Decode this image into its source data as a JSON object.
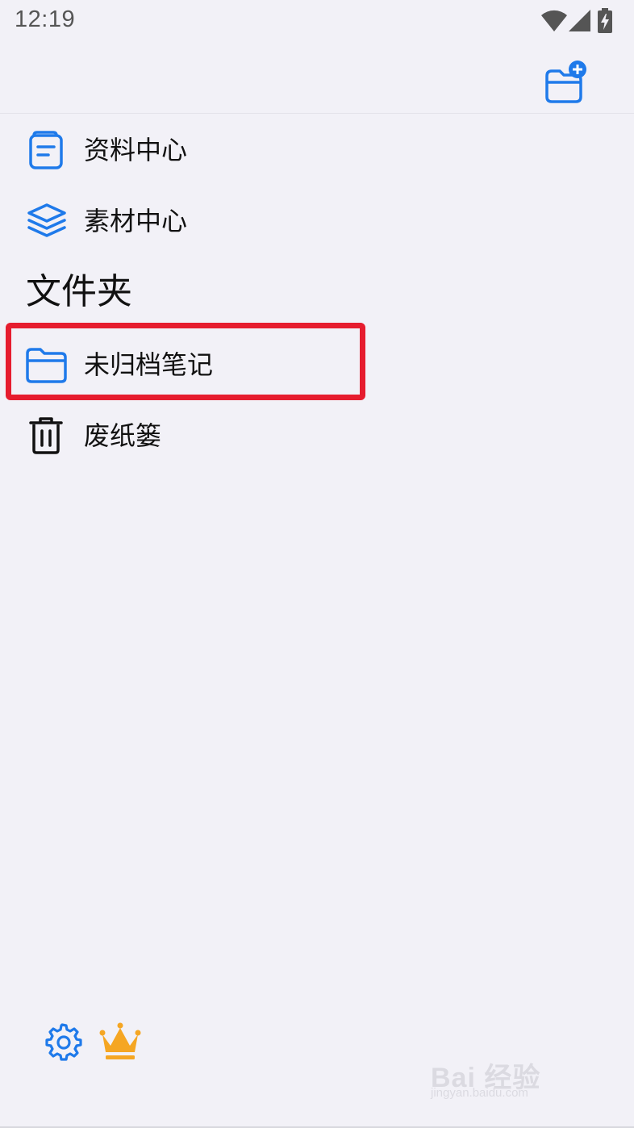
{
  "status_bar": {
    "time": "12:19",
    "icons": [
      "wifi-icon",
      "cell-signal-icon",
      "battery-charging-icon"
    ]
  },
  "toolbar": {
    "new_folder_icon": "folder-plus-icon"
  },
  "menu": {
    "items": [
      {
        "label": "资料中心",
        "icon": "document-icon"
      },
      {
        "label": "素材中心",
        "icon": "layers-icon"
      }
    ]
  },
  "folders": {
    "section_title": "文件夹",
    "items": [
      {
        "label": "未归档笔记",
        "icon": "folder-icon",
        "highlighted": true
      },
      {
        "label": "废纸篓",
        "icon": "trash-icon"
      }
    ]
  },
  "bottom": {
    "settings_icon": "gear-icon",
    "premium_icon": "crown-icon"
  },
  "watermark": {
    "text": "Bai 经验",
    "sub": "jingyan.baidu.com"
  },
  "colors": {
    "background": "#f2f1f7",
    "accent": "#1f7aea",
    "highlight": "#e61c2e",
    "crown": "#f5a623"
  }
}
